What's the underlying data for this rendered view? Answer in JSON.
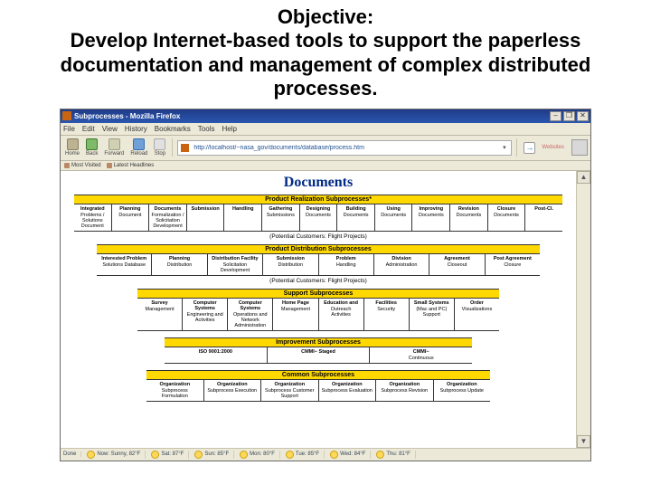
{
  "slide": {
    "objective_heading": "Objective:",
    "objective_body": "Develop Internet-based tools to support the paperless documentation and management of complex distributed processes."
  },
  "browser": {
    "window_title": "Subprocesses - Mozilla Firefox",
    "window_controls": {
      "min": "–",
      "max": "❐",
      "close": "✕"
    },
    "menu": [
      "File",
      "Edit",
      "View",
      "History",
      "Bookmarks",
      "Tools",
      "Help"
    ],
    "toolbar": {
      "home": "Home",
      "back": "Back",
      "forward": "Forward",
      "reload": "Reload",
      "stop": "Stop"
    },
    "url": "http://localhost/~nasa_gov/documents/database/process.htm",
    "url_dropdown": "▾",
    "go_button": "→",
    "bookmark_items": [
      "Most Visited",
      "Latest Headlines"
    ],
    "scroll_up": "▲",
    "scroll_down": "▼",
    "status": [
      {
        "icon": true,
        "text": "Now: Sunny, 82°F"
      },
      {
        "icon": true,
        "text": "Sat: 87°F"
      },
      {
        "icon": true,
        "text": "Sun: 85°F"
      },
      {
        "icon": true,
        "text": "Mon: 80°F"
      },
      {
        "icon": true,
        "text": "Tue: 85°F"
      },
      {
        "icon": true,
        "text": "Wed: 84°F"
      },
      {
        "icon": true,
        "text": "Thu: 81°F"
      }
    ],
    "status_prefix": "Done"
  },
  "doc": {
    "page_title": "Documents",
    "bands": [
      {
        "id": "product-realization",
        "title": "Product Realization Subprocesses*",
        "caption": "(Potential Customers: Flight Projects)",
        "items": [
          {
            "t": "Integrated",
            "s": "Problems / Solutions Document"
          },
          {
            "t": "Planning",
            "s": "Document"
          },
          {
            "t": "Documents",
            "s": "Formalization / Solicitation Development"
          },
          {
            "t": "Submission",
            "s": ""
          },
          {
            "t": "Handling",
            "s": ""
          },
          {
            "t": "Gathering",
            "s": "Submissions"
          },
          {
            "t": "Designing",
            "s": "Documents"
          },
          {
            "t": "Building",
            "s": "Documents"
          },
          {
            "t": "Using",
            "s": "Documents"
          },
          {
            "t": "Improving",
            "s": "Documents"
          },
          {
            "t": "Revision",
            "s": "Documents"
          },
          {
            "t": "Closure",
            "s": "Documents"
          },
          {
            "t": "Post-Cl.",
            "s": ""
          }
        ]
      },
      {
        "id": "product-distribution",
        "title": "Product Distribution Subprocesses",
        "caption": "(Potential Customers: Flight Projects)",
        "items": [
          {
            "t": "Interested Problem",
            "s": "Solutions Database"
          },
          {
            "t": "Planning",
            "s": "Distribution"
          },
          {
            "t": "Distribution Facility",
            "s": "Solicitation Development"
          },
          {
            "t": "Submission",
            "s": "Distribution"
          },
          {
            "t": "Problem",
            "s": "Handling"
          },
          {
            "t": "Division",
            "s": "Administration"
          },
          {
            "t": "Agreement",
            "s": "Closeout"
          },
          {
            "t": "Post Agreement",
            "s": "Closure"
          }
        ]
      },
      {
        "id": "support",
        "title": "Support Subprocesses",
        "caption": "",
        "items": [
          {
            "t": "Survey",
            "s": "Management"
          },
          {
            "t": "Computer Systems",
            "s": "Engineering and Activities"
          },
          {
            "t": "Computer Systems",
            "s": "Operations and Network Administration"
          },
          {
            "t": "Home Page",
            "s": "Management"
          },
          {
            "t": "Education and",
            "s": "Outreach Activities"
          },
          {
            "t": "Facilities",
            "s": "Security"
          },
          {
            "t": "Small Systems",
            "s": "(Mac and PC) Support"
          },
          {
            "t": "Order",
            "s": "Visualizations"
          }
        ]
      },
      {
        "id": "improvement",
        "title": "Improvement Subprocesses",
        "caption": "",
        "items": [
          {
            "t": "ISO 9001:2000",
            "s": ""
          },
          {
            "t": "CMMI− Staged",
            "s": ""
          },
          {
            "t": "CMMI−",
            "s": "Continuous"
          }
        ]
      },
      {
        "id": "common",
        "title": "Common Subprocesses",
        "caption": "",
        "items": [
          {
            "t": "Organization",
            "s": "Subprocess Formulation"
          },
          {
            "t": "Organization",
            "s": "Subprocess Execution"
          },
          {
            "t": "Organization",
            "s": "Subprocess Customer Support"
          },
          {
            "t": "Organization",
            "s": "Subprocess Evaluation"
          },
          {
            "t": "Organization",
            "s": "Subprocess Revision"
          },
          {
            "t": "Organization",
            "s": "Subprocess Update"
          }
        ]
      }
    ]
  }
}
